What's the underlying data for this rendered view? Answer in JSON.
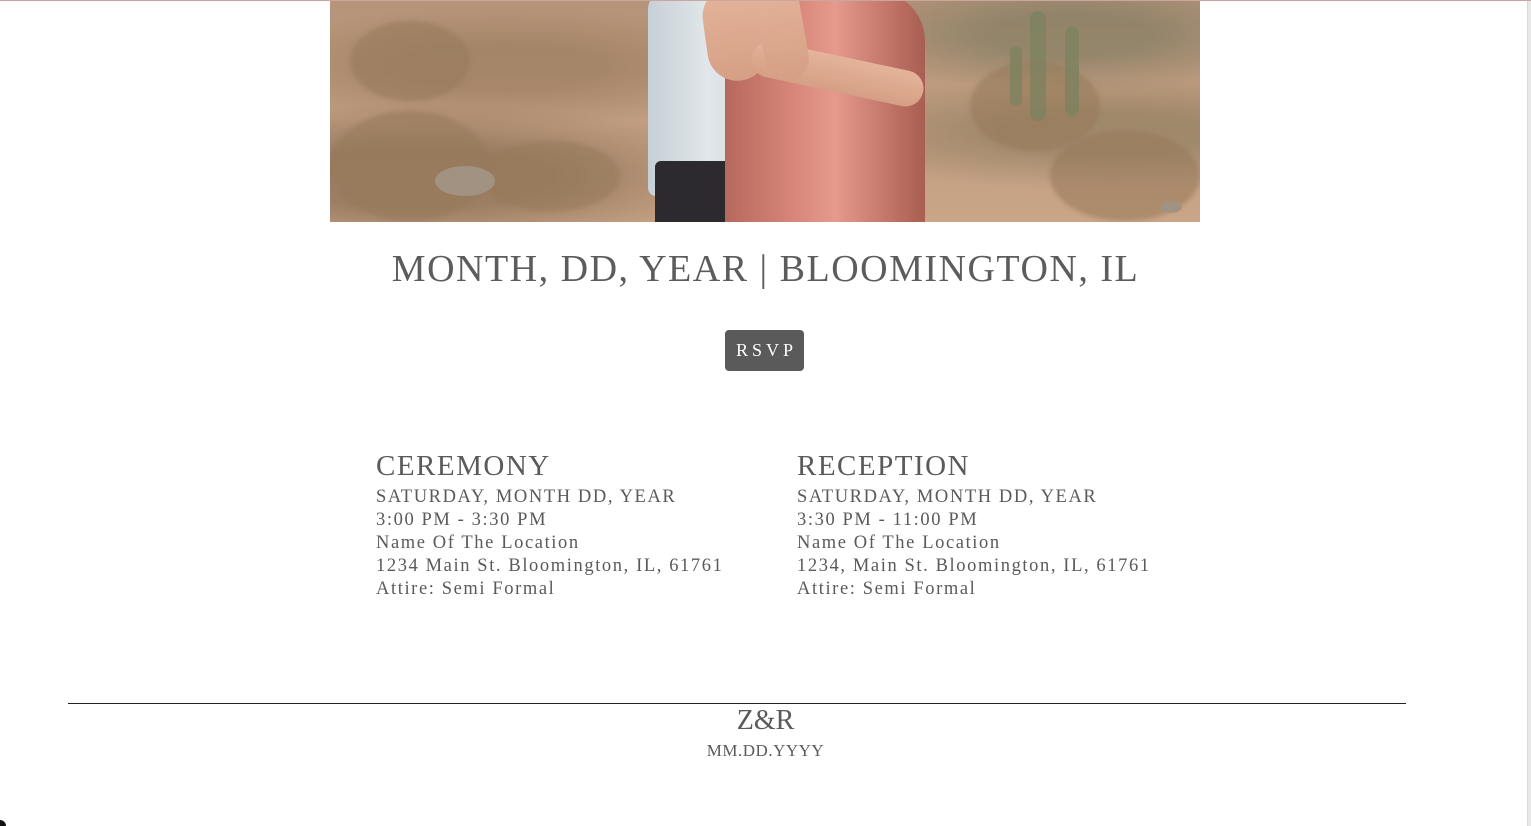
{
  "hero": {
    "image_icon": "photo-couple-embrace-desert"
  },
  "header": {
    "date_location": "MONTH, DD, YEAR | BLOOMINGTON, IL"
  },
  "rsvp": {
    "label": "RSVP"
  },
  "ceremony": {
    "title": "CEREMONY",
    "date": "SATURDAY, MONTH DD, YEAR",
    "time": "3:00 PM - 3:30 PM",
    "venue": "Name Of The Location",
    "address": "1234 Main St. Bloomington, IL, 61761",
    "attire": "Attire: Semi Formal"
  },
  "reception": {
    "title": "RECEPTION",
    "date": "SATURDAY, MONTH DD, YEAR",
    "time": "3:30 PM - 11:00 PM",
    "venue": "Name Of The Location",
    "address": "1234, Main St. Bloomington, IL, 61761",
    "attire": "Attire: Semi Formal"
  },
  "footer": {
    "monogram": "Z&R",
    "date": "MM.DD.YYYY"
  },
  "colors": {
    "text": "#5a5a5a",
    "button_bg": "#5a5a5a",
    "button_text": "#ffffff",
    "rule": "#222222"
  }
}
